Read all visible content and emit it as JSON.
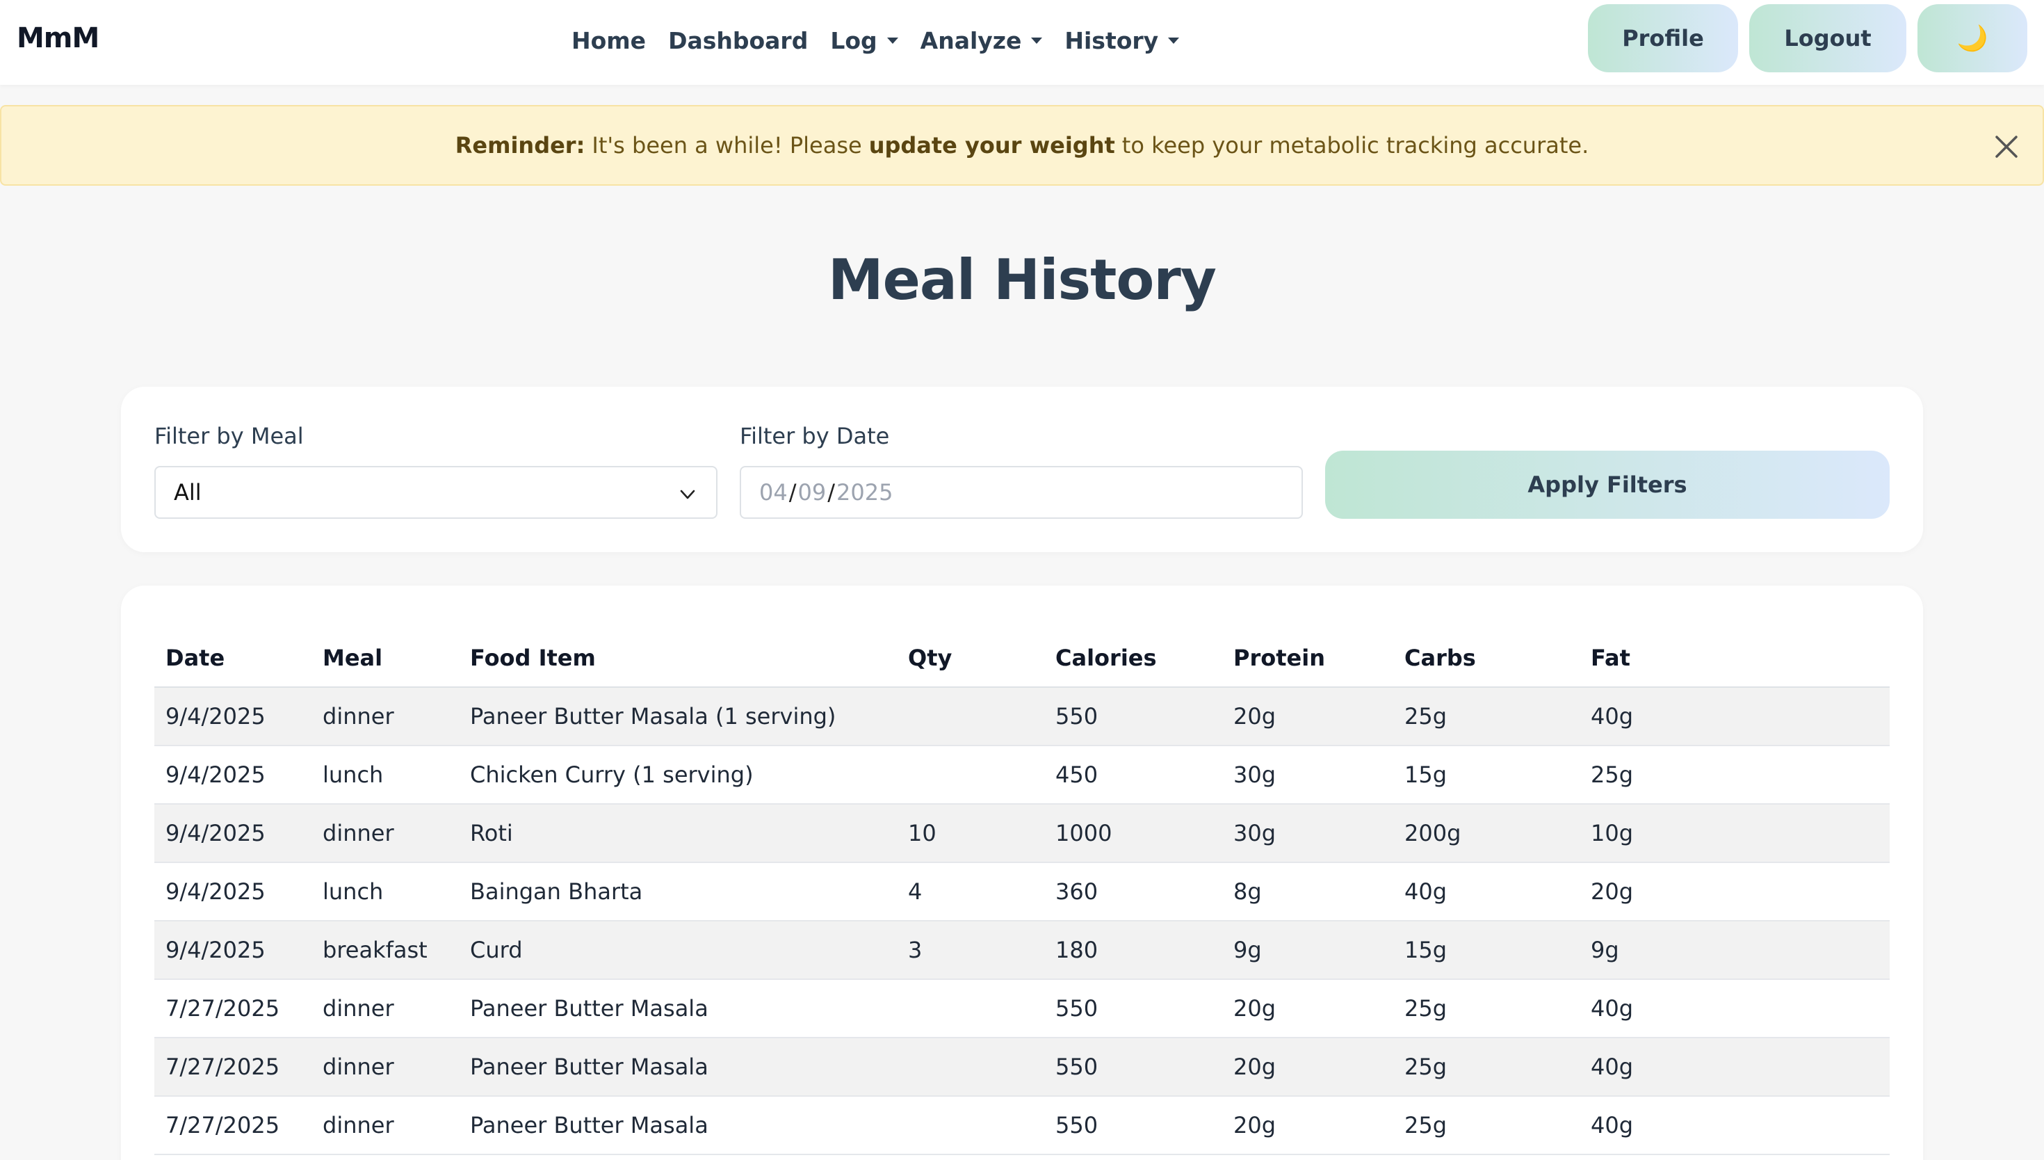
{
  "navbar": {
    "brand": "MmM",
    "links": [
      {
        "label": "Home",
        "dropdown": false
      },
      {
        "label": "Dashboard",
        "dropdown": false
      },
      {
        "label": "Log",
        "dropdown": true
      },
      {
        "label": "Analyze",
        "dropdown": true
      },
      {
        "label": "History",
        "dropdown": true
      }
    ],
    "profile_label": "Profile",
    "logout_label": "Logout",
    "theme_icon": "🌙"
  },
  "alert": {
    "strong_prefix": "Reminder:",
    "text_before": "It's been a while! Please",
    "strong_middle": "update your weight",
    "text_after": "to keep your metabolic tracking accurate."
  },
  "page": {
    "title": "Meal History"
  },
  "filters": {
    "meal_label": "Filter by Meal",
    "meal_value": "All",
    "date_label": "Filter by Date",
    "date_month": "04",
    "date_day": "09",
    "date_year": "2025",
    "apply_label": "Apply Filters"
  },
  "table": {
    "headers": [
      "Date",
      "Meal",
      "Food Item",
      "Qty",
      "Calories",
      "Protein",
      "Carbs",
      "Fat"
    ],
    "rows": [
      [
        "9/4/2025",
        "dinner",
        "Paneer Butter Masala (1 serving)",
        "",
        "550",
        "20g",
        "25g",
        "40g"
      ],
      [
        "9/4/2025",
        "lunch",
        "Chicken Curry (1 serving)",
        "",
        "450",
        "30g",
        "15g",
        "25g"
      ],
      [
        "9/4/2025",
        "dinner",
        "Roti",
        "10",
        "1000",
        "30g",
        "200g",
        "10g"
      ],
      [
        "9/4/2025",
        "lunch",
        "Baingan Bharta",
        "4",
        "360",
        "8g",
        "40g",
        "20g"
      ],
      [
        "9/4/2025",
        "breakfast",
        "Curd",
        "3",
        "180",
        "9g",
        "15g",
        "9g"
      ],
      [
        "7/27/2025",
        "dinner",
        "Paneer Butter Masala",
        "",
        "550",
        "20g",
        "25g",
        "40g"
      ],
      [
        "7/27/2025",
        "dinner",
        "Paneer Butter Masala",
        "",
        "550",
        "20g",
        "25g",
        "40g"
      ],
      [
        "7/27/2025",
        "dinner",
        "Paneer Butter Masala",
        "",
        "550",
        "20g",
        "25g",
        "40g"
      ]
    ]
  }
}
